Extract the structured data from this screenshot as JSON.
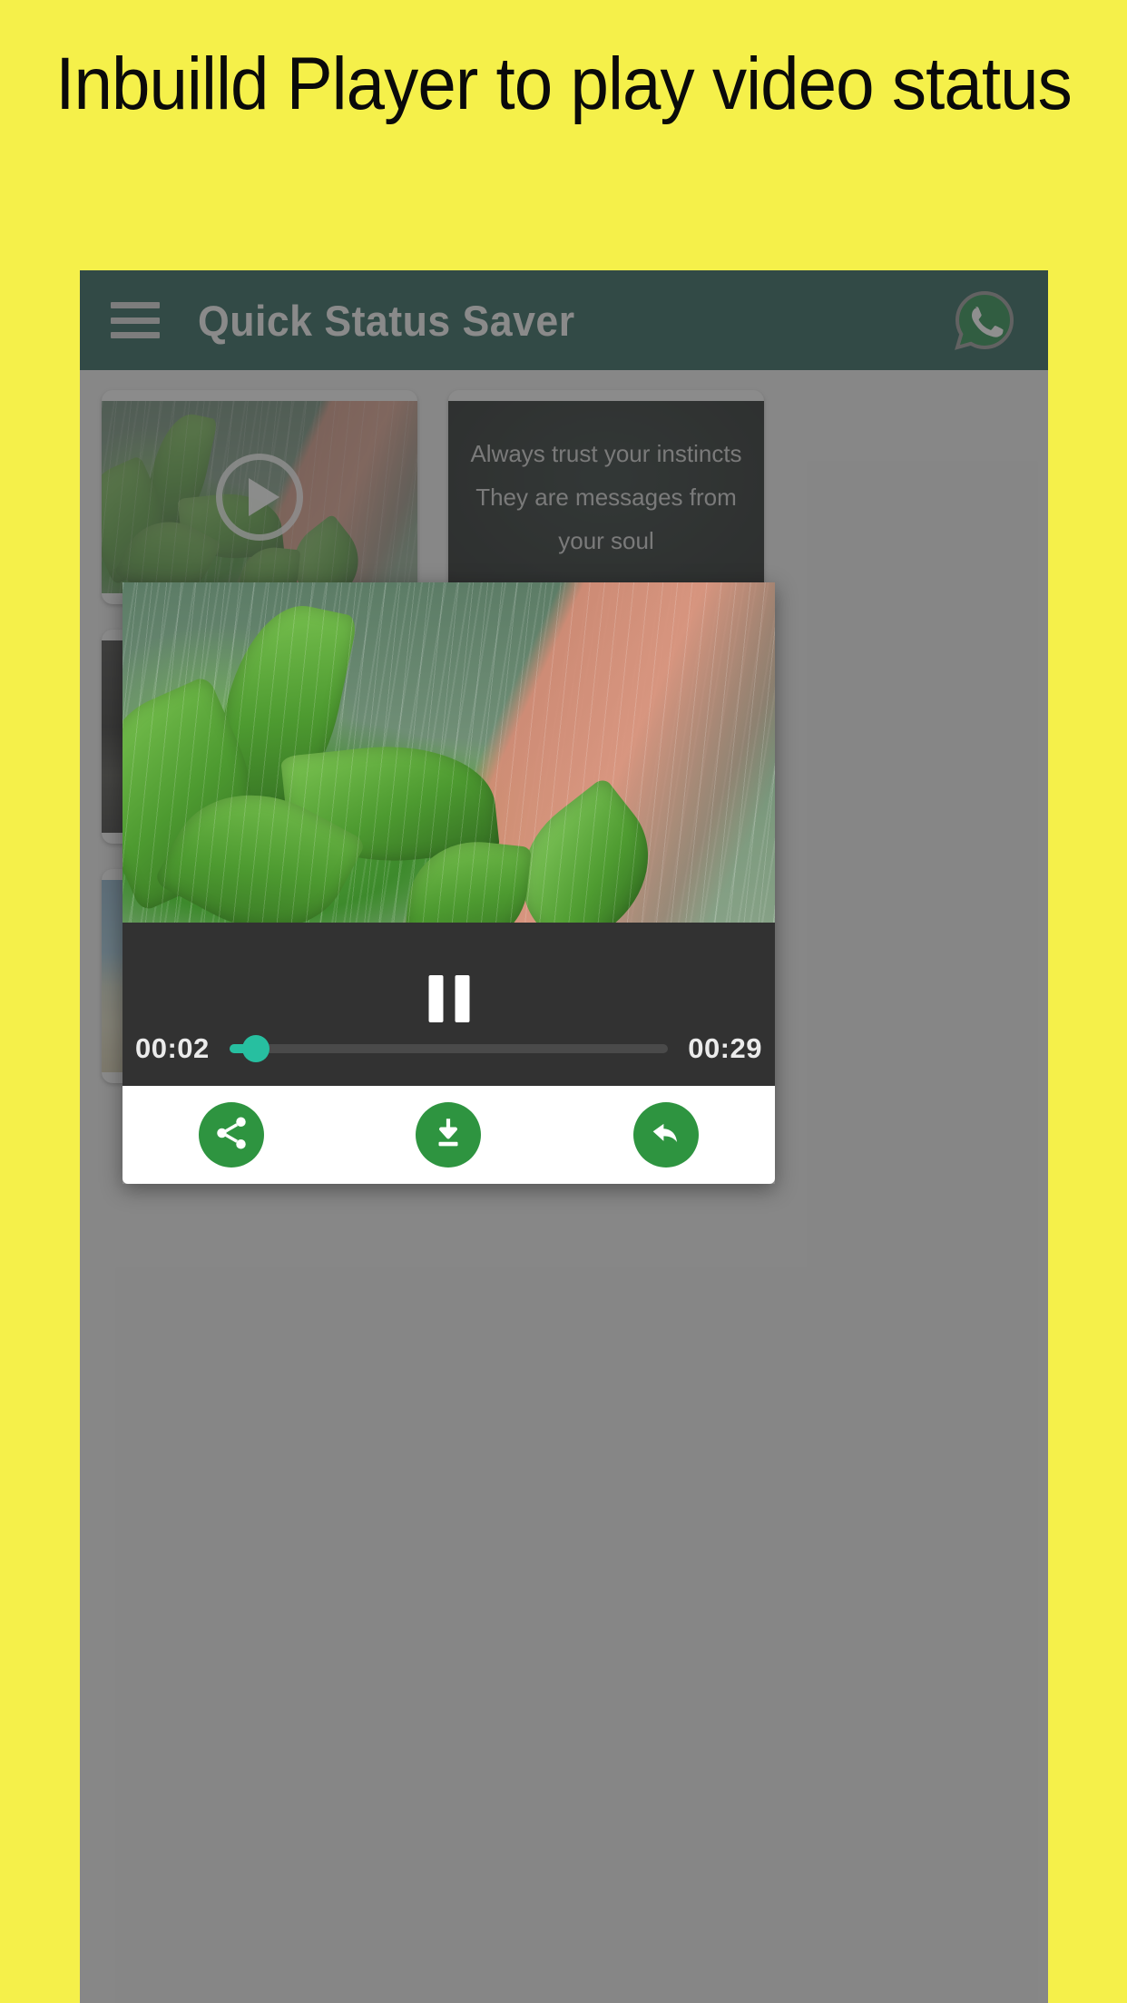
{
  "promo": {
    "headline": "Inbuilld Player to play video status",
    "background_color": "#f5f04a"
  },
  "app": {
    "appbar": {
      "title": "Quick Status Saver",
      "background_color": "#0d4a3f",
      "menu_icon": "hamburger-menu-icon",
      "whatsapp_icon": "whatsapp-icon"
    },
    "gallery": {
      "items": [
        {
          "kind": "video",
          "overlay_icon": "play-icon",
          "caption": ""
        },
        {
          "kind": "image",
          "overlay_icon": "",
          "quote_lines": [
            "Always trust your instincts",
            "They are messages from",
            "your soul"
          ]
        },
        {
          "kind": "video",
          "overlay_icon": "play-icon",
          "caption": ""
        },
        {
          "kind": "image",
          "overlay_icon": "",
          "caption": ""
        },
        {
          "kind": "image",
          "overlay_icon": "",
          "caption": ""
        },
        {
          "kind": "image",
          "overlay_icon": "",
          "caption": ""
        }
      ]
    },
    "player": {
      "state": "playing",
      "pause_icon": "pause-icon",
      "current_time": "00:02",
      "total_time": "00:29",
      "progress_percent": 6,
      "accent_color": "#27bfa0",
      "controls_background": "#323232",
      "actions": [
        {
          "name": "share",
          "icon": "share-icon",
          "color": "#2e9440"
        },
        {
          "name": "download",
          "icon": "download-icon",
          "color": "#2e9440"
        },
        {
          "name": "repost",
          "icon": "reply-arrow-icon",
          "color": "#2e9440"
        }
      ]
    }
  }
}
